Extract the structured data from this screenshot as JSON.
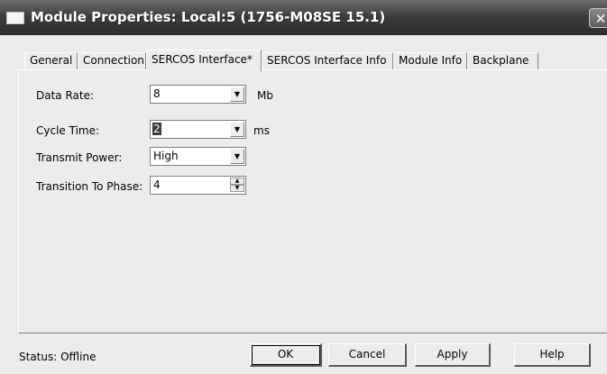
{
  "window": {
    "title": "Module Properties: Local:5 (1756-M08SE 15.1)",
    "close_glyph": "✕"
  },
  "tabs": [
    {
      "label": "General"
    },
    {
      "label": "Connection"
    },
    {
      "label": "SERCOS Interface*"
    },
    {
      "label": "SERCOS Interface Info"
    },
    {
      "label": "Module Info"
    },
    {
      "label": "Backplane"
    }
  ],
  "active_tab_index": 2,
  "form": {
    "data_rate": {
      "label": "Data Rate:",
      "value": "8",
      "unit": "Mb"
    },
    "cycle_time": {
      "label": "Cycle Time:",
      "value": "2",
      "unit": "ms"
    },
    "transmit_power": {
      "label": "Transmit Power:",
      "value": "High"
    },
    "transition_to_phase": {
      "label": "Transition To Phase:",
      "value": "4"
    }
  },
  "status": {
    "text": "Status:  Offline"
  },
  "buttons": {
    "ok": "OK",
    "cancel": "Cancel",
    "apply": "Apply",
    "help": "Help"
  },
  "icons": {
    "dropdown": "▼",
    "spin_up": "▲",
    "spin_down": "▼"
  }
}
